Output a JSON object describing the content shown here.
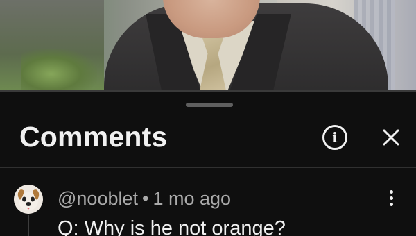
{
  "video": {
    "progress_fraction": 0.0
  },
  "comments_panel": {
    "title": "Comments",
    "info_icon": "info-icon",
    "info_glyph": "i",
    "close_icon": "close-icon",
    "more_icon": "more-vertical-icon"
  },
  "comments": [
    {
      "author": "@nooblet",
      "separator": "•",
      "time": "1 mo ago",
      "text": "Q: Why is he not orange?",
      "avatar_icon": "puppy-avatar-icon"
    }
  ]
}
